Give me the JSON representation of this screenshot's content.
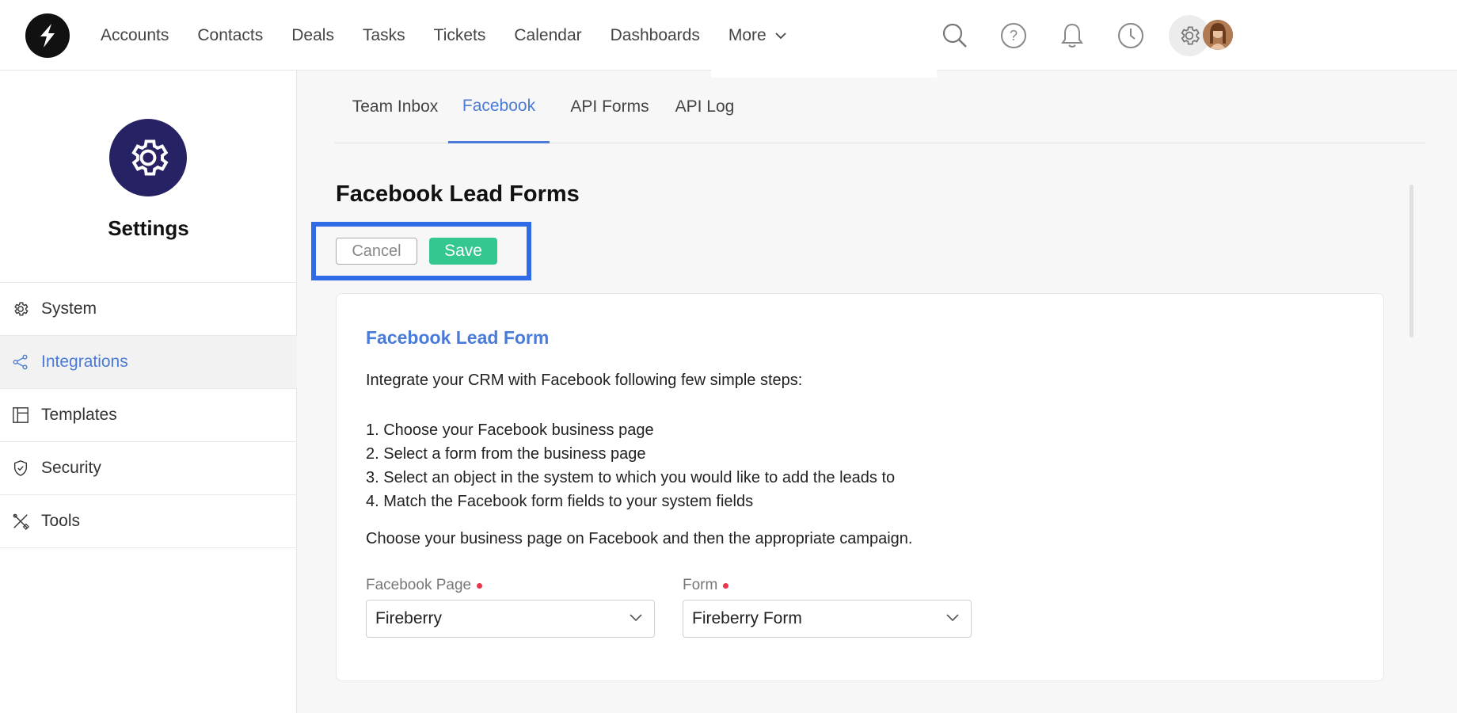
{
  "nav": {
    "items": [
      "Accounts",
      "Contacts",
      "Deals",
      "Tasks",
      "Tickets",
      "Calendar",
      "Dashboards",
      "More"
    ]
  },
  "top_icons": [
    "search-icon",
    "help-icon",
    "bell-icon",
    "clock-icon",
    "gear-icon",
    "avatar"
  ],
  "sidebar": {
    "title": "Settings",
    "items": [
      {
        "label": "System",
        "icon": "gear-icon"
      },
      {
        "label": "Integrations",
        "icon": "share-icon"
      },
      {
        "label": "Templates",
        "icon": "layout-icon"
      },
      {
        "label": "Security",
        "icon": "shield-icon"
      },
      {
        "label": "Tools",
        "icon": "tools-icon"
      }
    ],
    "active_item": "Integrations"
  },
  "tabs": [
    "Team Inbox",
    "Facebook",
    "API Forms",
    "API Log"
  ],
  "active_tab": "Facebook",
  "page": {
    "title": "Facebook Lead Forms",
    "cancel_label": "Cancel",
    "save_label": "Save"
  },
  "card": {
    "title": "Facebook Lead Form",
    "intro": "Integrate your CRM with Facebook following few simple steps:",
    "steps": [
      "1. Choose your Facebook business page",
      "2. Select a form from the business page",
      "3. Select an object in the system to which you would like to add the leads to",
      "4. Match the Facebook form fields to your system fields"
    ],
    "choose_text": "Choose your business page on Facebook and then the appropriate campaign.",
    "fields": [
      {
        "label": "Facebook Page",
        "value": "Fireberry",
        "required": true
      },
      {
        "label": "Form",
        "value": "Fireberry Form",
        "required": true
      }
    ]
  },
  "colors": {
    "accent": "#4a7bd8",
    "save": "#34c78f",
    "settings_badge": "#272263",
    "highlight": "#2f6be6",
    "required": "#e8364f"
  }
}
